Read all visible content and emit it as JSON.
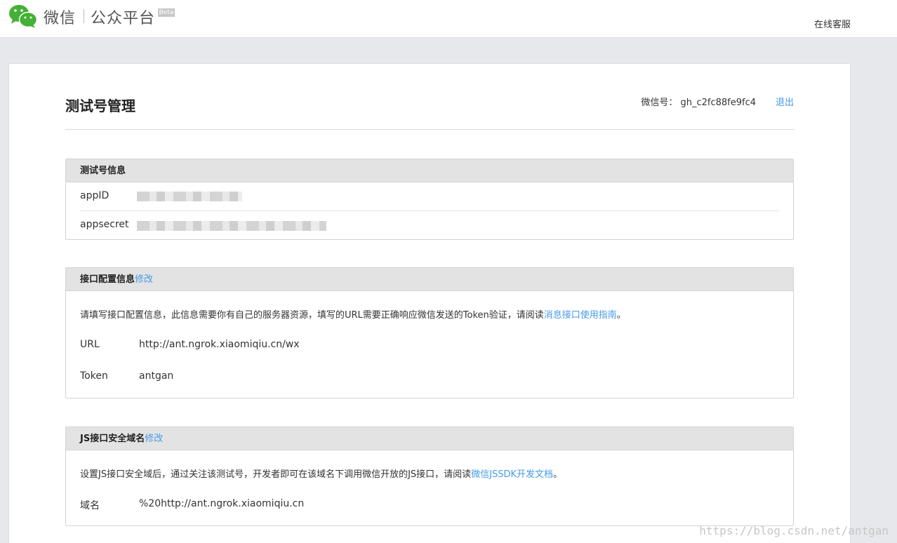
{
  "brand": {
    "weixin": "微信",
    "platform": "公众平台",
    "beta": "Beta",
    "accent": "#44b035"
  },
  "topbar": {
    "service_label": "在线客服"
  },
  "header": {
    "title": "测试号管理",
    "account_label": "微信号：",
    "account_value": "gh_c2fc88fe9fc4",
    "logout_label": "退出"
  },
  "test_info": {
    "title": "测试号信息",
    "appid_label": "appID",
    "appsecret_label": "appsecret"
  },
  "interface_config": {
    "title": "接口配置信息",
    "edit_label": "修改",
    "description": "请填写接口配置信息，此信息需要你有自己的服务器资源，填写的URL需要正确响应微信发送的Token验证，请阅读",
    "guide_link": "消息接口使用指南",
    "period": "。",
    "url_label": "URL",
    "url_value": "http://ant.ngrok.xiaomiqiu.cn/wx",
    "token_label": "Token",
    "token_value": "antgan"
  },
  "js_domain": {
    "title": "JS接口安全域名",
    "edit_label": "修改",
    "description": "设置JS接口安全域后，通过关注该测试号，开发者即可在该域名下调用微信开放的JS接口，请阅读",
    "doc_link": "微信JSSDK开发文档",
    "period": "。",
    "domain_label": "域名",
    "domain_value": "%20http://ant.ngrok.xiaomiqiu.cn"
  },
  "watermark": "https://blog.csdn.net/antgan",
  "colors": {
    "link": "#459ae9",
    "panel_head": "#e3e3e3",
    "background": "#e7e8eb"
  }
}
